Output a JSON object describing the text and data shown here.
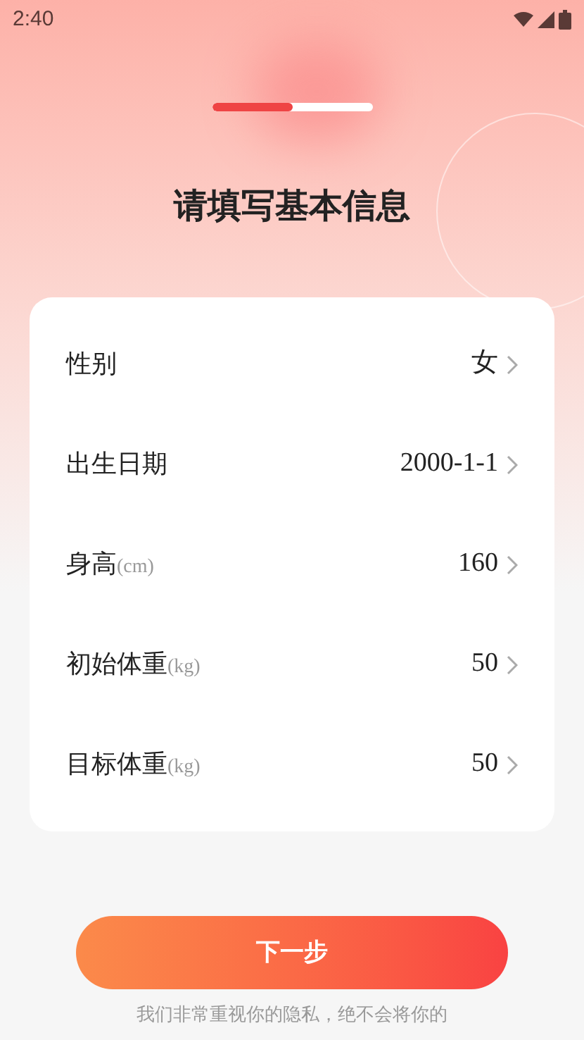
{
  "status_bar": {
    "time": "2:40"
  },
  "progress": {
    "level": 0.5
  },
  "title": "请填写基本信息",
  "fields": [
    {
      "label": "性别",
      "value": "女"
    },
    {
      "label": "出生日期",
      "value": "2000-1-1"
    },
    {
      "label": "身高",
      "unit": "(cm)",
      "value": "160"
    },
    {
      "label": "初始体重",
      "unit": "(kg)",
      "value": "50"
    },
    {
      "label": "目标体重",
      "unit": "(kg)",
      "value": "50"
    }
  ],
  "next_button": "下一步",
  "privacy_note": "我们非常重视你的隐私，绝不会将你的"
}
